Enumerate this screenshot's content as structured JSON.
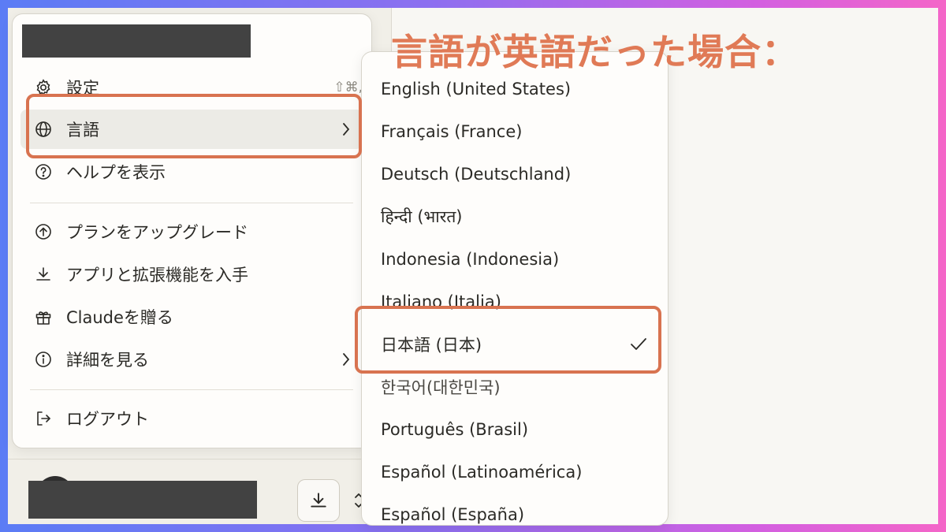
{
  "callout": "言語が英語だった場合：",
  "main_menu": {
    "items": [
      {
        "label": "設定",
        "icon": "gear-icon",
        "shortcut": "⇧⌘,"
      },
      {
        "label": "言語",
        "icon": "globe-icon",
        "chevron": true
      },
      {
        "label": "ヘルプを表示",
        "icon": "question-circle-icon"
      },
      {
        "label": "プランをアップグレード",
        "icon": "arrow-up-circle-icon"
      },
      {
        "label": "アプリと拡張機能を入手",
        "icon": "download-icon"
      },
      {
        "label": "Claudeを贈る",
        "icon": "gift-icon"
      },
      {
        "label": "詳細を見る",
        "icon": "info-circle-icon",
        "chevron": true
      },
      {
        "label": "ログアウト",
        "icon": "logout-icon"
      }
    ]
  },
  "language_menu": {
    "items": [
      {
        "label": "English (United States)"
      },
      {
        "label": "Français (France)"
      },
      {
        "label": "Deutsch (Deutschland)"
      },
      {
        "label": "हिन्दी (भारत)"
      },
      {
        "label": "Indonesia (Indonesia)"
      },
      {
        "label": "Italiano (Italia)"
      },
      {
        "label": "日本語 (日本)",
        "selected": true
      },
      {
        "label": "한국어(대한민국)"
      },
      {
        "label": "Português (Brasil)"
      },
      {
        "label": "Español (Latinoamérica)"
      },
      {
        "label": "Español (España)"
      }
    ]
  },
  "colors": {
    "accent": "#d87350",
    "callout": "#e07a56",
    "redaction": "#424242"
  }
}
